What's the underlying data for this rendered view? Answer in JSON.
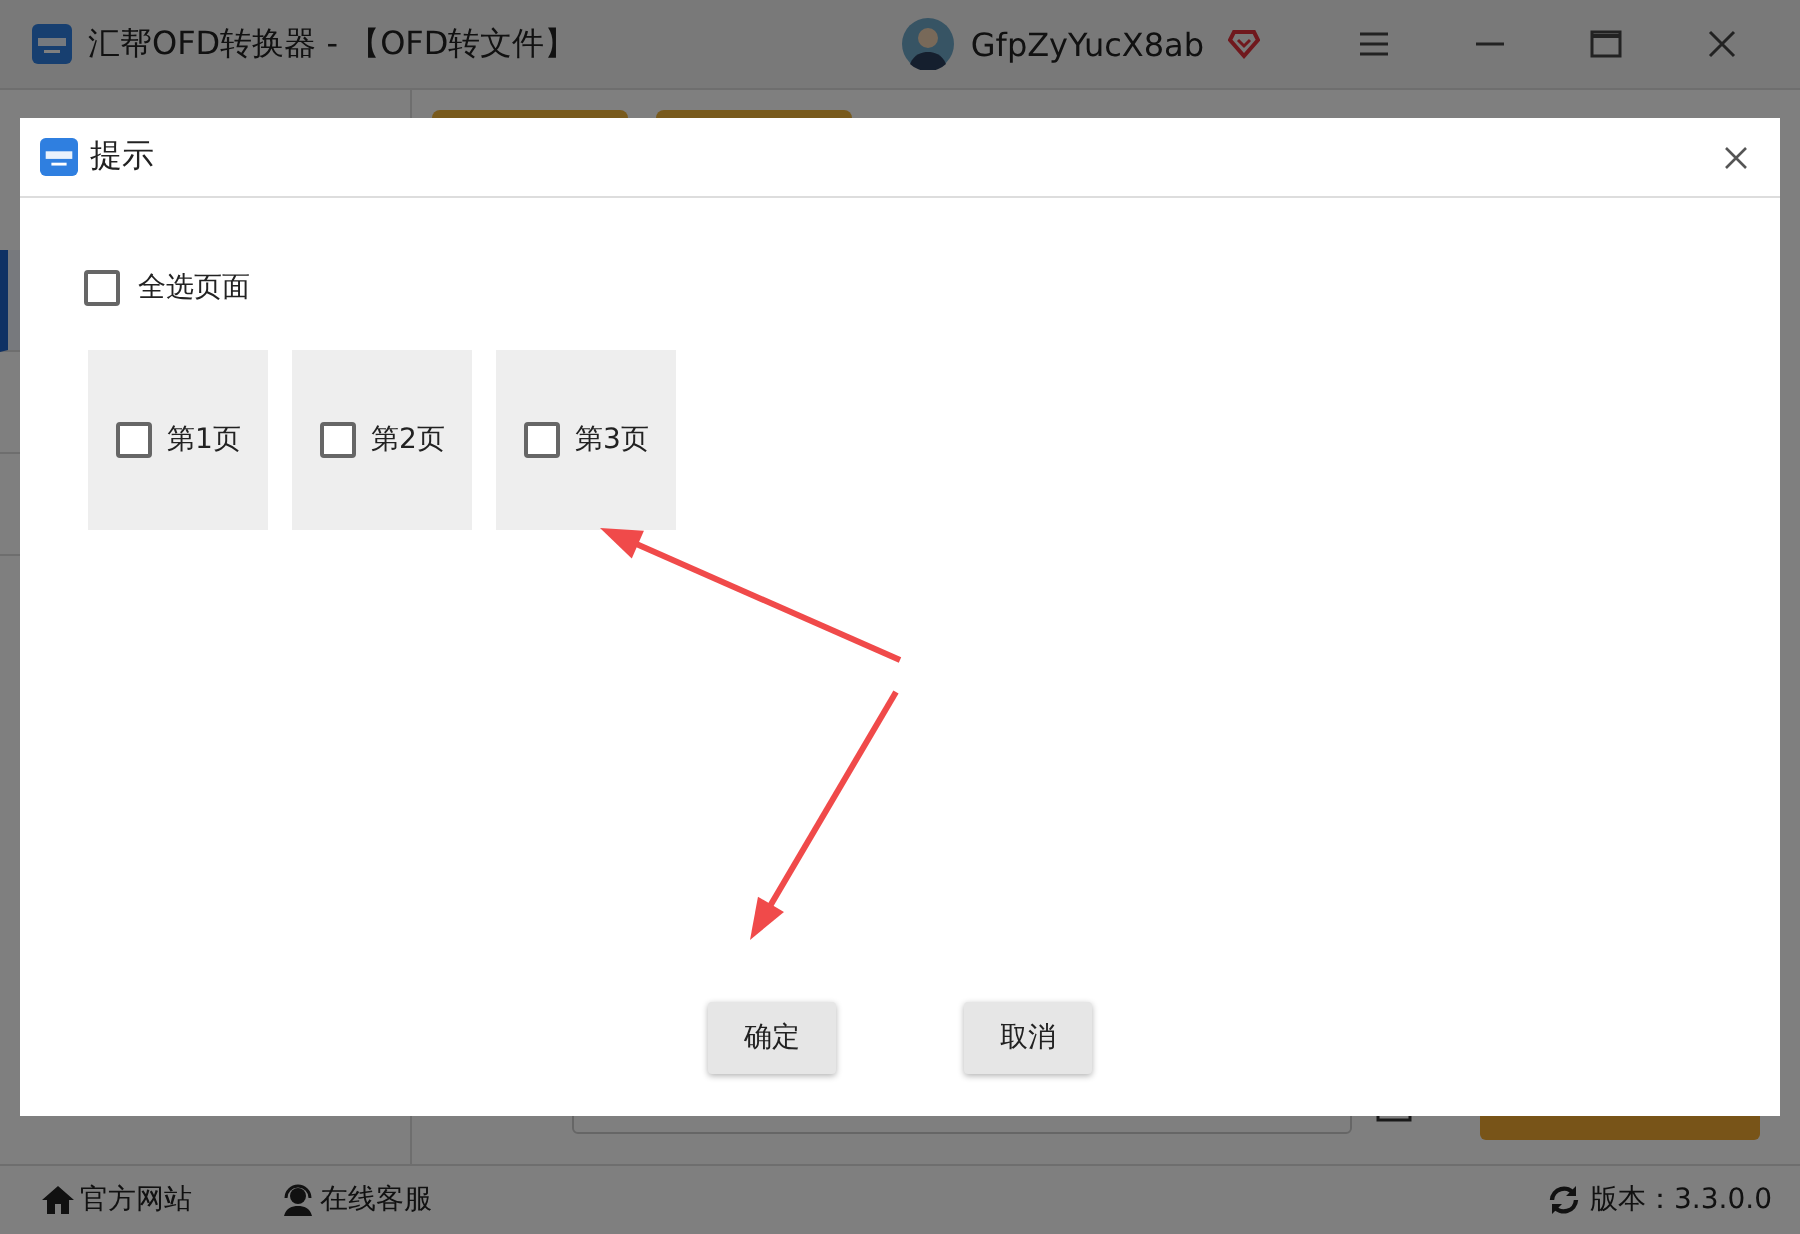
{
  "window": {
    "title": "汇帮OFD转换器 - 【OFD转文件】",
    "user": "GfpZyYucX8ab"
  },
  "sidebar": {
    "items": [
      {
        "selected": true
      },
      {
        "selected": false
      },
      {
        "selected": false
      }
    ]
  },
  "footer": {
    "links": [
      "官方网站",
      "在线客服"
    ],
    "version": "版本：3.3.0.0"
  },
  "dialog": {
    "title": "提示",
    "select_all": {
      "label": "全选页面",
      "checked": false
    },
    "pages": [
      {
        "label": "第1页",
        "checked": false
      },
      {
        "label": "第2页",
        "checked": false
      },
      {
        "label": "第3页",
        "checked": false
      }
    ],
    "buttons": [
      "确定",
      "取消"
    ]
  }
}
